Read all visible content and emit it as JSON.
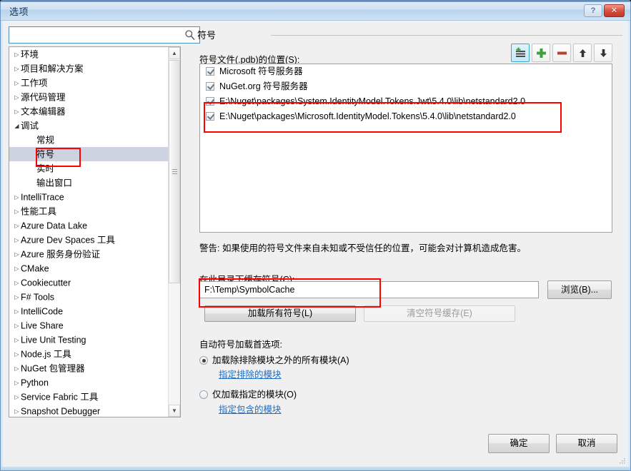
{
  "window": {
    "title": "选项",
    "help_button": "?",
    "close_button": "✕"
  },
  "search": {
    "value": "",
    "placeholder": "",
    "icon": "search-icon"
  },
  "tree": {
    "items": [
      {
        "label": "环境",
        "level": 0,
        "expander": "collapsed",
        "selected": false
      },
      {
        "label": "项目和解决方案",
        "level": 0,
        "expander": "collapsed",
        "selected": false
      },
      {
        "label": "工作项",
        "level": 0,
        "expander": "collapsed",
        "selected": false
      },
      {
        "label": "源代码管理",
        "level": 0,
        "expander": "collapsed",
        "selected": false
      },
      {
        "label": "文本编辑器",
        "level": 0,
        "expander": "collapsed",
        "selected": false
      },
      {
        "label": "调试",
        "level": 0,
        "expander": "expanded",
        "selected": false
      },
      {
        "label": "常规",
        "level": 1,
        "expander": "none",
        "selected": false
      },
      {
        "label": "符号",
        "level": 1,
        "expander": "none",
        "selected": true
      },
      {
        "label": "实时",
        "level": 1,
        "expander": "none",
        "selected": false
      },
      {
        "label": "输出窗口",
        "level": 1,
        "expander": "none",
        "selected": false
      },
      {
        "label": "IntelliTrace",
        "level": 0,
        "expander": "collapsed",
        "selected": false
      },
      {
        "label": "性能工具",
        "level": 0,
        "expander": "collapsed",
        "selected": false
      },
      {
        "label": "Azure Data Lake",
        "level": 0,
        "expander": "collapsed",
        "selected": false
      },
      {
        "label": "Azure Dev Spaces 工具",
        "level": 0,
        "expander": "collapsed",
        "selected": false
      },
      {
        "label": "Azure 服务身份验证",
        "level": 0,
        "expander": "collapsed",
        "selected": false
      },
      {
        "label": "CMake",
        "level": 0,
        "expander": "collapsed",
        "selected": false
      },
      {
        "label": "Cookiecutter",
        "level": 0,
        "expander": "collapsed",
        "selected": false
      },
      {
        "label": "F# Tools",
        "level": 0,
        "expander": "collapsed",
        "selected": false
      },
      {
        "label": "IntelliCode",
        "level": 0,
        "expander": "collapsed",
        "selected": false
      },
      {
        "label": "Live Share",
        "level": 0,
        "expander": "collapsed",
        "selected": false
      },
      {
        "label": "Live Unit Testing",
        "level": 0,
        "expander": "collapsed",
        "selected": false
      },
      {
        "label": "Node.js 工具",
        "level": 0,
        "expander": "collapsed",
        "selected": false
      },
      {
        "label": "NuGet 包管理器",
        "level": 0,
        "expander": "collapsed",
        "selected": false
      },
      {
        "label": "Python",
        "level": 0,
        "expander": "collapsed",
        "selected": false
      },
      {
        "label": "Service Fabric 工具",
        "level": 0,
        "expander": "collapsed",
        "selected": false
      },
      {
        "label": "Snapshot Debugger",
        "level": 0,
        "expander": "collapsed",
        "selected": false
      }
    ],
    "scrollbar": {
      "up_arrow": "▲",
      "down_arrow": "▼"
    }
  },
  "page": {
    "title": "符号",
    "symbol_files_label": "符号文件(.pdb)的位置(S):",
    "toolbar": [
      {
        "name": "new-location-icon",
        "tooltip": "",
        "active": true
      },
      {
        "name": "add-icon",
        "tooltip": "",
        "active": false
      },
      {
        "name": "remove-icon",
        "tooltip": "",
        "active": false
      },
      {
        "name": "move-up-icon",
        "tooltip": "",
        "active": false
      },
      {
        "name": "move-down-icon",
        "tooltip": "",
        "active": false
      }
    ],
    "symbol_locations": [
      {
        "label": "Microsoft 符号服务器",
        "checked": true,
        "highlighted": false
      },
      {
        "label": "NuGet.org 符号服务器",
        "checked": true,
        "highlighted": false
      },
      {
        "label": "E:\\Nuget\\packages\\System.IdentityModel.Tokens.Jwt\\5.4.0\\lib\\netstandard2.0",
        "checked": true,
        "highlighted": true
      },
      {
        "label": "E:\\Nuget\\packages\\Microsoft.IdentityModel.Tokens\\5.4.0\\lib\\netstandard2.0",
        "checked": true,
        "highlighted": true
      }
    ],
    "warning": "警告: 如果使用的符号文件来自未知或不受信任的位置，可能会对计算机造成危害。",
    "cache_label": "在此目录下缓存符号(C):",
    "cache_path": "F:\\Temp\\SymbolCache",
    "browse_button": "浏览(B)...",
    "load_all_button": "加载所有符号(L)",
    "clear_cache_button": "清空符号缓存(E)",
    "auto_load_label": "自动符号加载首选项:",
    "radio_all": "加载除排除模块之外的所有模块(A)",
    "link_exclude": "指定排除的模块",
    "radio_only": "仅加载指定的模块(O)",
    "link_include": "指定包含的模块",
    "selected_radio": "all"
  },
  "footer": {
    "ok_button": "确定",
    "cancel_button": "取消"
  },
  "colors": {
    "accent": "#4a7bb0",
    "annotation_red": "#ff0000",
    "selection": "#cdd3e0",
    "link": "#1f6fc4",
    "close_red": "#d9503c"
  }
}
